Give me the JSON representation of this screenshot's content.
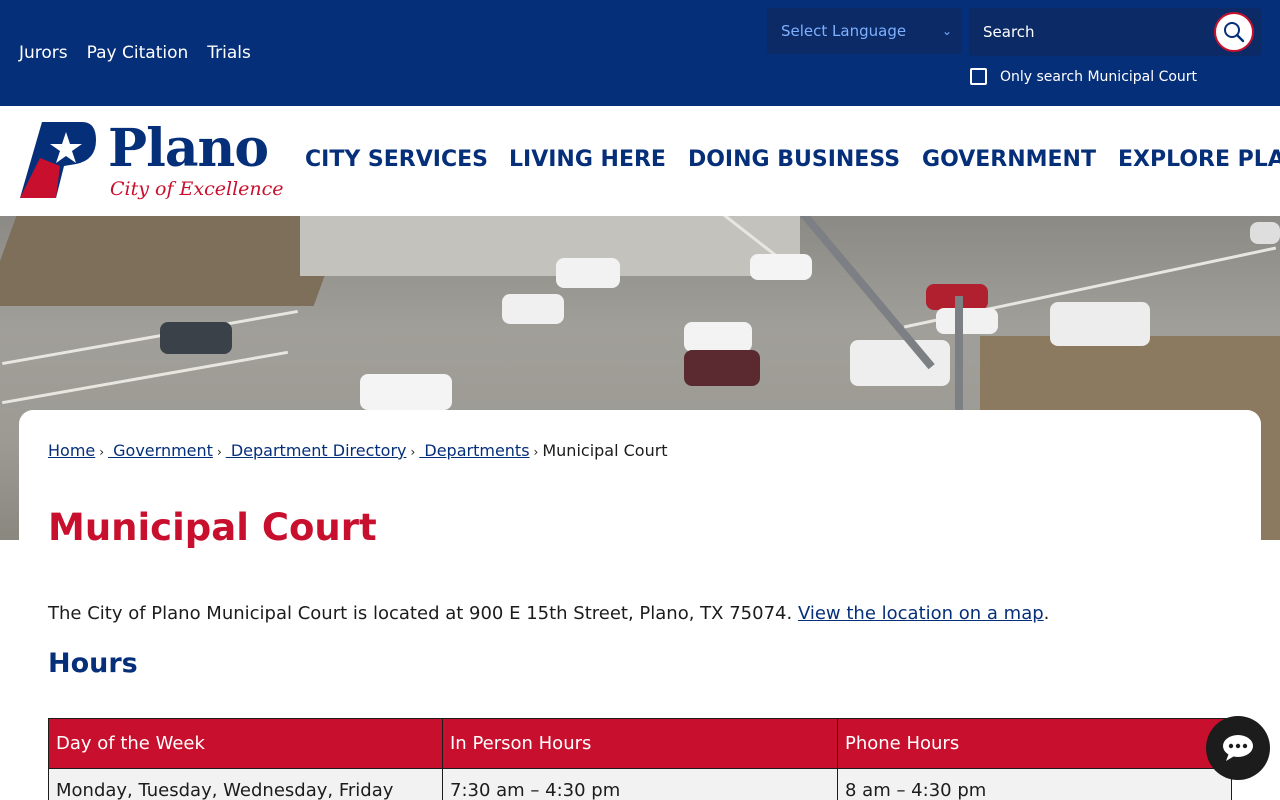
{
  "topbar": {
    "quicklinks": [
      {
        "label": "Jurors"
      },
      {
        "label": "Pay Citation"
      },
      {
        "label": "Trials"
      }
    ],
    "language_select": "Select Language",
    "search_placeholder": "Search",
    "only_search_label": "Only search Municipal Court"
  },
  "header": {
    "logo_word": "Plano",
    "logo_tagline": "City of Excellence",
    "nav": [
      {
        "label": "CITY SERVICES"
      },
      {
        "label": "LIVING HERE"
      },
      {
        "label": "DOING BUSINESS"
      },
      {
        "label": "GOVERNMENT"
      },
      {
        "label": "EXPLORE PLANO"
      }
    ]
  },
  "breadcrumb": {
    "items": [
      {
        "label": "Home"
      },
      {
        "label": " Government"
      },
      {
        "label": " Department Directory"
      },
      {
        "label": " Departments"
      }
    ],
    "current": "Municipal Court",
    "separator": "›"
  },
  "main": {
    "title": "Municipal Court",
    "intro_text": "The City of Plano Municipal Court is located at 900 E 15th Street, Plano, TX 75074. ",
    "intro_link": "View the location on a map",
    "intro_end": ".",
    "hours_heading": "Hours",
    "table": {
      "headers": [
        "Day of the Week",
        "In Person Hours",
        "Phone Hours"
      ],
      "rows": [
        [
          "Monday, Tuesday, Wednesday, Friday",
          "7:30 am – 4:30 pm",
          "8 am – 4:30 pm"
        ]
      ]
    }
  },
  "colors": {
    "navy": "#062f7a",
    "red": "#c8102e"
  },
  "icons": {
    "search": "search-icon",
    "chat": "chat-icon",
    "logo": "plano-star-logo-icon"
  }
}
